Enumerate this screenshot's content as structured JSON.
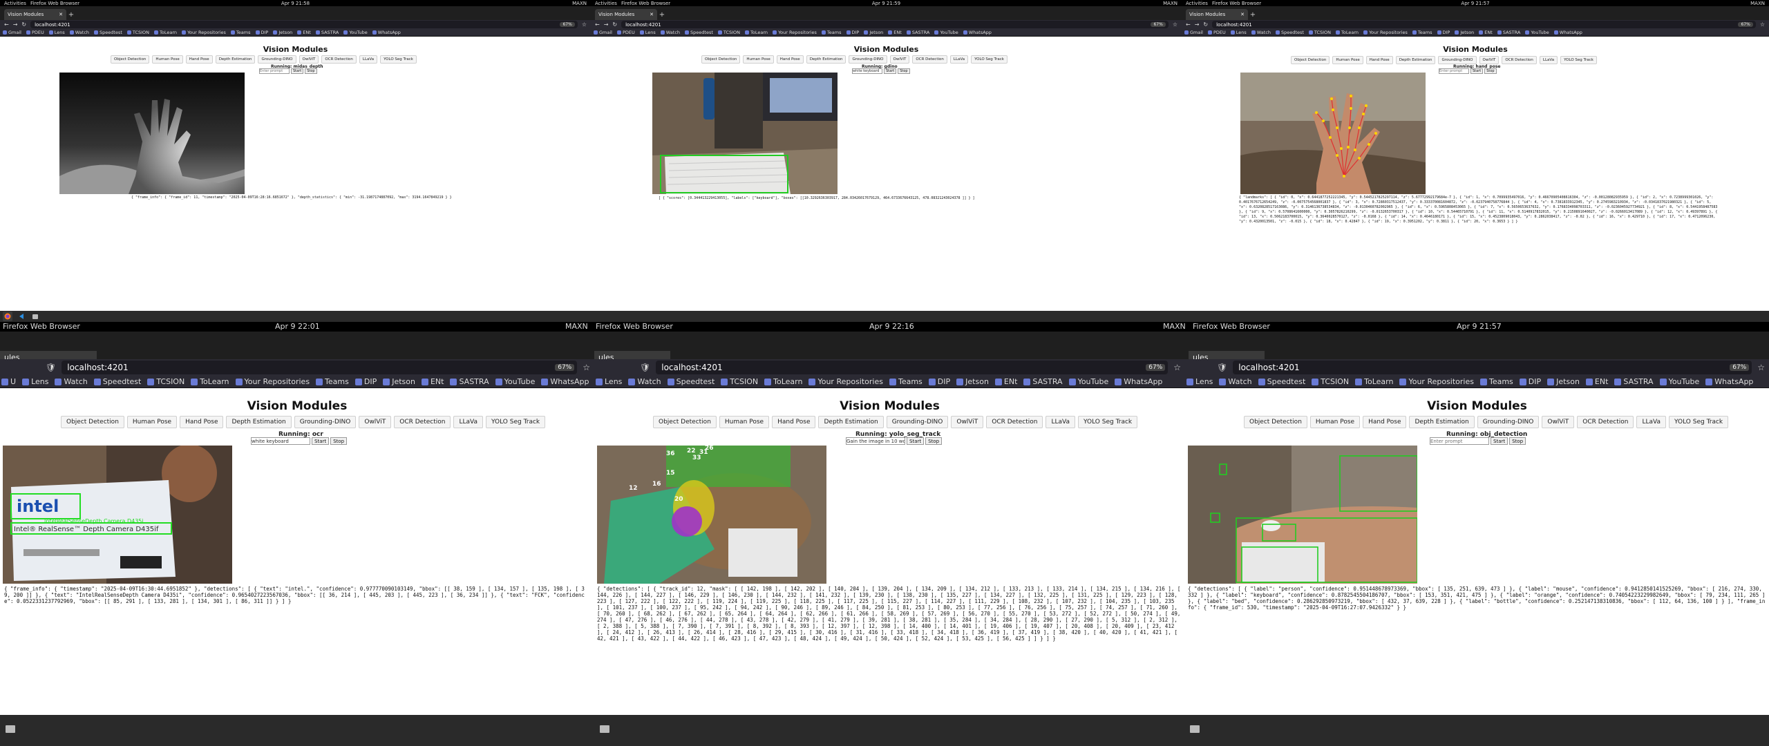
{
  "system": {
    "activities": "Activities",
    "app_menu": "Firefox Web Browser",
    "maxn": "MAXN",
    "clocks": [
      "Apr 9  21:58",
      "Apr 9  21:59",
      "Apr 9  21:57",
      "Apr 9  22:01",
      "Apr 9  22:16",
      "Apr 9  21:57"
    ]
  },
  "browser": {
    "tab_title": "Vision Modules",
    "tab_title_short": "ules",
    "url": "localhost:4201",
    "zoom": "67%",
    "bookmarks_full": [
      "Gmail",
      "PDEU",
      "Lens",
      "Watch",
      "Speedtest",
      "TCSION",
      "ToLearn",
      "Your Repositories",
      "Teams",
      "DIP",
      "Jetson",
      "ENt",
      "SASTRA",
      "YouTube",
      "WhatsApp"
    ],
    "bookmarks_mid": [
      "Lens",
      "Watch",
      "Speedtest",
      "TCSION",
      "ToLearn",
      "Your Repositories",
      "Teams",
      "DIP",
      "Jetson",
      "ENt",
      "SASTRA",
      "YouTube",
      "WhatsApp"
    ],
    "bookmarks_lower": [
      "U",
      "Lens",
      "Watch",
      "Speedtest",
      "TCSION",
      "ToLearn",
      "Your Repositories",
      "Teams",
      "DIP",
      "Jetson",
      "ENt",
      "SASTRA",
      "YouTube",
      "WhatsApp"
    ]
  },
  "app": {
    "title": "Vision Modules",
    "buttons": [
      "Object Detection",
      "Human Pose",
      "Hand Pose",
      "Depth Estimation",
      "Grounding-DINO",
      "OwlViT",
      "OCR Detection",
      "LLaVa",
      "YOLO Seg Track"
    ],
    "start_label": "Start",
    "stop_label": "Stop",
    "prompt_placeholder": "Enter prompt"
  },
  "panels": [
    {
      "running": "Running: midas_depth",
      "prompt_value": "",
      "output": "{ \"frame_info\": { \"frame_id\": 11, \"timestamp\": \"2025-04-09T16:28:16.6851672\" }, \"depth_statistics\": { \"min\": -31.1987174887092, \"max\": 3194.1647849219 } }"
    },
    {
      "running": "Running: gdino",
      "prompt_value": "white keyboard",
      "output": "[ { \"scores\": [0.344413229413055], \"labels\": [\"keyboard\"], \"boxes\": [[10.3292636303917, 284.03426017679129, 464.6733676643125, 478.08321243024378 ]] } ]",
      "overlay_labels": []
    },
    {
      "running": "Running: hand_pose",
      "prompt_value": "",
      "output": "{ \"landmarks\": [ { \"id\": 0, \"x\": 0.6441877252221345, \"y\": 0.5445217825297114, \"z\": 5.67772992179684e-7 }, { \"id\": 1, \"x\": 0.7099935497016, \"y\": 0.46670905408616304, \"z\": -0.00128082935959 }, { \"id\": 2, \"x\": 0.7238999301026, \"y\": 0.4017676712654249, \"z\": -0.0075754568001837 }, { \"id\": 3, \"x\": 0.72860317512437, \"y\": 0.333370081604872, \"z\": -0.0237940758776844 }, { \"id\": 4, \"x\": 0.7381833912345, \"y\": 0.2745983210934, \"z\": -0.0341837021980321 }, { \"id\": 5, \"x\": 0.6320828517163086, \"y\": 0.3146136738534834, \"z\": -0.0130460782002965 }, { \"id\": 6, \"x\": 0.5965808453065 }, { \"id\": 7, \"x\": 0.5650653637632, \"y\": 0.1768334098703311, \"z\": -0.0236045927734921 }, { \"id\": 8, \"x\": 0.5441958487583 }, { \"id\": 9, \"x\": 0.5708641600000, \"y\": 0.3057826210299, \"z\": -0.0132653700317 }, { \"id\": 10, \"x\": 0.54465710791 }, { \"id\": 11, \"x\": 0.5140917832015, \"y\": 0.2150891640027, \"z\": -0.0266013417089 }, { \"id\": 12, \"x\": 0.49397891 }, { \"id\": 13, \"x\": 0.5062183700015, \"y\": 0.3640028570127, \"z\": -0.0168 }, { \"id\": 14, \"x\": 0.4646180171 }, { \"id\": 15, \"x\": 0.4523809018043, \"y\": 0.2862038417, \"z\": -0.02 }, { \"id\": 16, \"x\": 0.429710 }, { \"id\": 17, \"x\": 0.4712096230, \"y\": 0.4320013501, \"z\": -0.015 }, { \"id\": 18, \"x\": 0.42847 }, { \"id\": 19, \"x\": 0.3951202, \"y\": 0.3811 }, { \"id\": 20, \"x\": 0.3653 } ] }"
    },
    {
      "running": "Running: ocr",
      "prompt_value": "white keyboard",
      "output": "{ \"frame_info\": { \"timestamp\": \"2025-04-09T16:30:44.6951852\" }, \"detections\": [ { \"text\": \"intel.\", \"confidence\": 0.977770090103149, \"bbox\": [[ 38, 159 ], [ 134, 157 ], [ 135, 198 ], [ 39, 200 ]] }, { \"text\": \"IntelRealSenseDepth Camera D435i\", \"confidence\": 0.9654027223567036, \"bbox\": [[ 36, 214 ], [ 445, 203 ], [ 445, 223 ], [ 36, 234 ]] }, { \"text\": \"FCK\", \"confidence\": 0.0522331237792969, \"bbox\": [[ 85, 291 ], [ 133, 281 ], [ 134, 301 ], [ 86, 311 ]] } ] }",
      "overlay": {
        "logo": "intel",
        "product": "Intel® RealSense™ Depth Camera D435if",
        "detected": "IntelRealSenseDepth Camera D435i"
      }
    },
    {
      "running": "Running: yolo_seg_track",
      "prompt_value": "Gain the image in 10 words",
      "output": "{ \"detections\": [ { \"track_id\": 12, \"mask\": [ [ 142, 198 ], [ 142, 202 ], [ 140, 204 ], [ 139, 204 ], [ 134, 209 ], [ 134, 212 ], [ 133, 213 ], [ 133, 214 ], [ 134, 215 ], [ 134, 216 ], [ 144, 226 ], [ 144, 227 ], [ 146, 229 ], [ 146, 230 ], [ 144, 232 ], [ 141, 232 ], [ 139, 230 ], [ 138, 230 ], [ 135, 227 ], [ 134, 227 ], [ 132, 225 ], [ 131, 225 ], [ 129, 223 ], [ 128, 223 ], [ 127, 222 ], [ 122, 222 ], [ 119, 224 ], [ 119, 225 ], [ 118, 225 ], [ 117, 225 ], [ 115, 227 ], [ 114, 227 ], [ 111, 229 ], [ 108, 232 ], [ 107, 232 ], [ 104, 235 ], [ 103, 235 ], [ 101, 237 ], [ 100, 237 ], [ 95, 242 ], [ 94, 242 ], [ 90, 246 ], [ 89, 246 ], [ 84, 250 ], [ 81, 253 ], [ 80, 253 ], [ 77, 256 ], [ 76, 256 ], [ 75, 257 ], [ 74, 257 ], [ 71, 260 ], [ 70, 260 ], [ 68, 262 ], [ 67, 262 ], [ 65, 264 ], [ 64, 264 ], [ 62, 266 ], [ 61, 266 ], [ 58, 269 ], [ 57, 269 ], [ 56, 270 ], [ 55, 270 ], [ 53, 272 ], [ 52, 272 ], [ 50, 274 ], [ 49, 274 ], [ 47, 276 ], [ 46, 276 ], [ 44, 278 ], [ 43, 278 ], [ 42, 279 ], [ 41, 279 ], [ 39, 281 ], [ 38, 281 ], [ 35, 284 ], [ 34, 284 ], [ 28, 290 ], [ 27, 290 ], [ 5, 312 ], [ 2, 312 ], [ 2, 388 ], [ 5, 388 ], [ 7, 390 ], [ 7, 391 ], [ 8, 392 ], [ 8, 393 ], [ 12, 397 ], [ 12, 398 ], [ 14, 400 ], [ 14, 401 ], [ 19, 406 ], [ 19, 407 ], [ 20, 408 ], [ 20, 409 ], [ 23, 412 ], [ 24, 412 ], [ 26, 413 ], [ 26, 414 ], [ 28, 416 ], [ 29, 415 ], [ 30, 416 ], [ 31, 416 ], [ 33, 418 ], [ 34, 418 ], [ 36, 419 ], [ 37, 419 ], [ 38, 420 ], [ 40, 420 ], [ 41, 421 ], [ 42, 421 ], [ 43, 422 ], [ 44, 422 ], [ 46, 423 ], [ 47, 423 ], [ 48, 424 ], [ 49, 424 ], [ 50, 424 ], [ 52, 424 ], [ 53, 425 ], [ 56, 425 ] ] } ] }",
      "tracks": [
        "36",
        "22",
        "33",
        "31",
        "26",
        "12",
        "15",
        "16",
        "20"
      ]
    },
    {
      "running": "Running: obj_detection",
      "prompt_value": "",
      "output": "{ \"detections\": [ { \"label\": \"person\", \"confidence\": 0.951448678973369, \"bbox\": [ 135, 251, 639, 473 ] }, { \"label\": \"mouse\", \"confidence\": 0.9412850141525269, \"bbox\": [ 216, 274, 330, 332 ] }, { \"label\": \"keyboard\", \"confidence\": 0.8782545504186707, \"bbox\": [ 153, 351, 421, 475 ] }, { \"label\": \"orange\", \"confidence\": 0.74054223229982649, \"bbox\": [ 79, 234, 111, 265 ] }, { \"label\": \"bed\", \"confidence\": 0.286292850973219, \"bbox\": [ 432, 37, 639, 228 ] }, { \"label\": \"bottle\", \"confidence\": 0.252147138310836, \"bbox\": [ 112, 64, 136, 100 ] } ], \"frame_info\": { \"frame_id\": 530, \"timestamp\": \"2025-04-09T16:27:07.9426332\" } }"
    }
  ]
}
